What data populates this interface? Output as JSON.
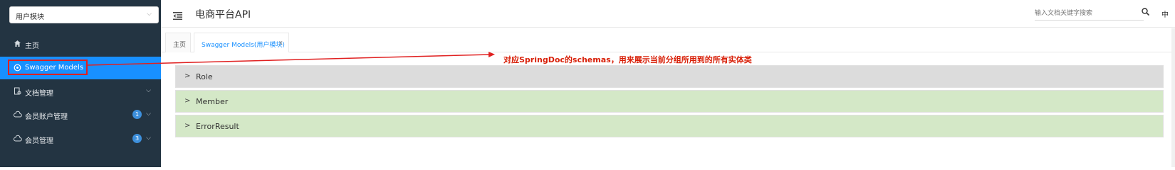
{
  "sidebar": {
    "group_select": "用户模块",
    "items": [
      {
        "label": "主页",
        "icon": "home-icon"
      },
      {
        "label": "Swagger Models",
        "icon": "model-icon"
      },
      {
        "label": "文档管理",
        "icon": "document-icon"
      },
      {
        "label": "会员账户管理",
        "icon": "cloud-icon",
        "badge": "1"
      },
      {
        "label": "会员管理",
        "icon": "cloud-icon",
        "badge": "3"
      }
    ]
  },
  "header": {
    "title": "电商平台API",
    "search_placeholder": "输入文档关键字搜索",
    "lang": "中"
  },
  "tabs": [
    {
      "label": "主页"
    },
    {
      "label": "Swagger Models(用户模块)",
      "close": "x"
    }
  ],
  "annotation": "对应SpringDoc的schemas，用来展示当前分组所用到的所有实体类",
  "models": [
    {
      "name": "Role"
    },
    {
      "name": "Member"
    },
    {
      "name": "ErrorResult"
    }
  ],
  "colors": {
    "sidebar_bg": "#233442",
    "active": "#1890ff",
    "annotation": "#d81e06",
    "row_grey": "#dcdcdc",
    "row_green": "#d4e8c7"
  }
}
